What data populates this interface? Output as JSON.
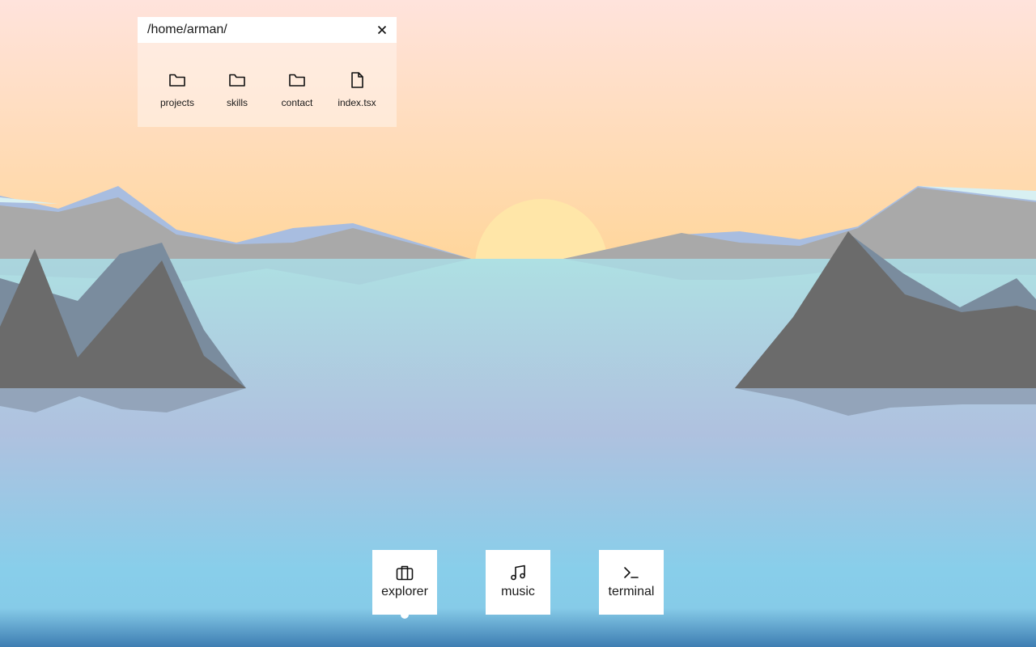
{
  "explorer": {
    "path": "/home/arman/",
    "close_label": "✕",
    "items": [
      {
        "label": "projects",
        "icon": "folder-icon"
      },
      {
        "label": "skills",
        "icon": "folder-icon"
      },
      {
        "label": "contact",
        "icon": "folder-icon"
      },
      {
        "label": "index.tsx",
        "icon": "file-icon"
      }
    ]
  },
  "dock": {
    "apps": [
      {
        "label": "explorer",
        "icon": "briefcase-icon",
        "running": true
      },
      {
        "label": "music",
        "icon": "music-note-icon",
        "running": false
      },
      {
        "label": "terminal",
        "icon": "terminal-icon",
        "running": false
      }
    ]
  },
  "colors": {
    "sky_top": "#ffe3dc",
    "sky_bottom": "#ffd8a0",
    "sun": "#ffe6a8",
    "water_top": "#aedfe4",
    "water_mid": "#b0c0e0",
    "water_bottom": "#3f7fb3",
    "mountain_dark": "#6b6b6b",
    "mountain_light": "#a8a8a8",
    "mountain_blue": "#a8bde0",
    "window_bar": "#ffffff",
    "dock_tile": "#ffffff"
  }
}
